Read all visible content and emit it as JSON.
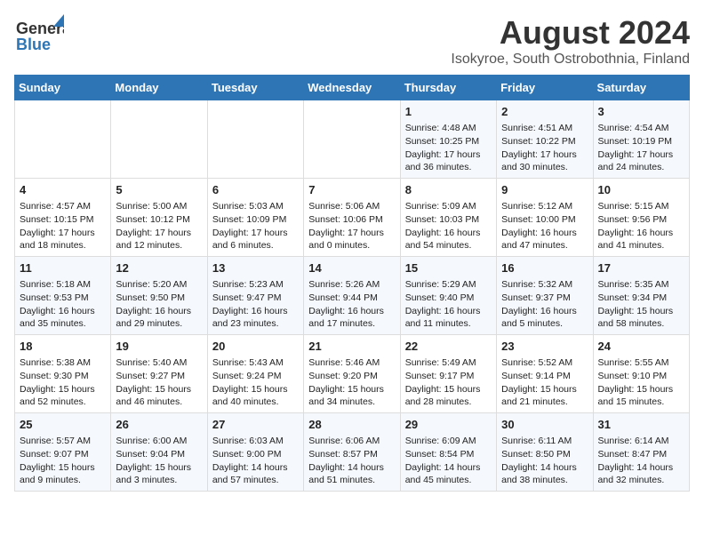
{
  "header": {
    "logo_line1": "General",
    "logo_line2": "Blue",
    "title": "August 2024",
    "subtitle": "Isokyroe, South Ostrobothnia, Finland"
  },
  "weekdays": [
    "Sunday",
    "Monday",
    "Tuesday",
    "Wednesday",
    "Thursday",
    "Friday",
    "Saturday"
  ],
  "rows": [
    [
      {
        "day": "",
        "info": ""
      },
      {
        "day": "",
        "info": ""
      },
      {
        "day": "",
        "info": ""
      },
      {
        "day": "",
        "info": ""
      },
      {
        "day": "1",
        "info": "Sunrise: 4:48 AM\nSunset: 10:25 PM\nDaylight: 17 hours\nand 36 minutes."
      },
      {
        "day": "2",
        "info": "Sunrise: 4:51 AM\nSunset: 10:22 PM\nDaylight: 17 hours\nand 30 minutes."
      },
      {
        "day": "3",
        "info": "Sunrise: 4:54 AM\nSunset: 10:19 PM\nDaylight: 17 hours\nand 24 minutes."
      }
    ],
    [
      {
        "day": "4",
        "info": "Sunrise: 4:57 AM\nSunset: 10:15 PM\nDaylight: 17 hours\nand 18 minutes."
      },
      {
        "day": "5",
        "info": "Sunrise: 5:00 AM\nSunset: 10:12 PM\nDaylight: 17 hours\nand 12 minutes."
      },
      {
        "day": "6",
        "info": "Sunrise: 5:03 AM\nSunset: 10:09 PM\nDaylight: 17 hours\nand 6 minutes."
      },
      {
        "day": "7",
        "info": "Sunrise: 5:06 AM\nSunset: 10:06 PM\nDaylight: 17 hours\nand 0 minutes."
      },
      {
        "day": "8",
        "info": "Sunrise: 5:09 AM\nSunset: 10:03 PM\nDaylight: 16 hours\nand 54 minutes."
      },
      {
        "day": "9",
        "info": "Sunrise: 5:12 AM\nSunset: 10:00 PM\nDaylight: 16 hours\nand 47 minutes."
      },
      {
        "day": "10",
        "info": "Sunrise: 5:15 AM\nSunset: 9:56 PM\nDaylight: 16 hours\nand 41 minutes."
      }
    ],
    [
      {
        "day": "11",
        "info": "Sunrise: 5:18 AM\nSunset: 9:53 PM\nDaylight: 16 hours\nand 35 minutes."
      },
      {
        "day": "12",
        "info": "Sunrise: 5:20 AM\nSunset: 9:50 PM\nDaylight: 16 hours\nand 29 minutes."
      },
      {
        "day": "13",
        "info": "Sunrise: 5:23 AM\nSunset: 9:47 PM\nDaylight: 16 hours\nand 23 minutes."
      },
      {
        "day": "14",
        "info": "Sunrise: 5:26 AM\nSunset: 9:44 PM\nDaylight: 16 hours\nand 17 minutes."
      },
      {
        "day": "15",
        "info": "Sunrise: 5:29 AM\nSunset: 9:40 PM\nDaylight: 16 hours\nand 11 minutes."
      },
      {
        "day": "16",
        "info": "Sunrise: 5:32 AM\nSunset: 9:37 PM\nDaylight: 16 hours\nand 5 minutes."
      },
      {
        "day": "17",
        "info": "Sunrise: 5:35 AM\nSunset: 9:34 PM\nDaylight: 15 hours\nand 58 minutes."
      }
    ],
    [
      {
        "day": "18",
        "info": "Sunrise: 5:38 AM\nSunset: 9:30 PM\nDaylight: 15 hours\nand 52 minutes."
      },
      {
        "day": "19",
        "info": "Sunrise: 5:40 AM\nSunset: 9:27 PM\nDaylight: 15 hours\nand 46 minutes."
      },
      {
        "day": "20",
        "info": "Sunrise: 5:43 AM\nSunset: 9:24 PM\nDaylight: 15 hours\nand 40 minutes."
      },
      {
        "day": "21",
        "info": "Sunrise: 5:46 AM\nSunset: 9:20 PM\nDaylight: 15 hours\nand 34 minutes."
      },
      {
        "day": "22",
        "info": "Sunrise: 5:49 AM\nSunset: 9:17 PM\nDaylight: 15 hours\nand 28 minutes."
      },
      {
        "day": "23",
        "info": "Sunrise: 5:52 AM\nSunset: 9:14 PM\nDaylight: 15 hours\nand 21 minutes."
      },
      {
        "day": "24",
        "info": "Sunrise: 5:55 AM\nSunset: 9:10 PM\nDaylight: 15 hours\nand 15 minutes."
      }
    ],
    [
      {
        "day": "25",
        "info": "Sunrise: 5:57 AM\nSunset: 9:07 PM\nDaylight: 15 hours\nand 9 minutes."
      },
      {
        "day": "26",
        "info": "Sunrise: 6:00 AM\nSunset: 9:04 PM\nDaylight: 15 hours\nand 3 minutes."
      },
      {
        "day": "27",
        "info": "Sunrise: 6:03 AM\nSunset: 9:00 PM\nDaylight: 14 hours\nand 57 minutes."
      },
      {
        "day": "28",
        "info": "Sunrise: 6:06 AM\nSunset: 8:57 PM\nDaylight: 14 hours\nand 51 minutes."
      },
      {
        "day": "29",
        "info": "Sunrise: 6:09 AM\nSunset: 8:54 PM\nDaylight: 14 hours\nand 45 minutes."
      },
      {
        "day": "30",
        "info": "Sunrise: 6:11 AM\nSunset: 8:50 PM\nDaylight: 14 hours\nand 38 minutes."
      },
      {
        "day": "31",
        "info": "Sunrise: 6:14 AM\nSunset: 8:47 PM\nDaylight: 14 hours\nand 32 minutes."
      }
    ]
  ]
}
